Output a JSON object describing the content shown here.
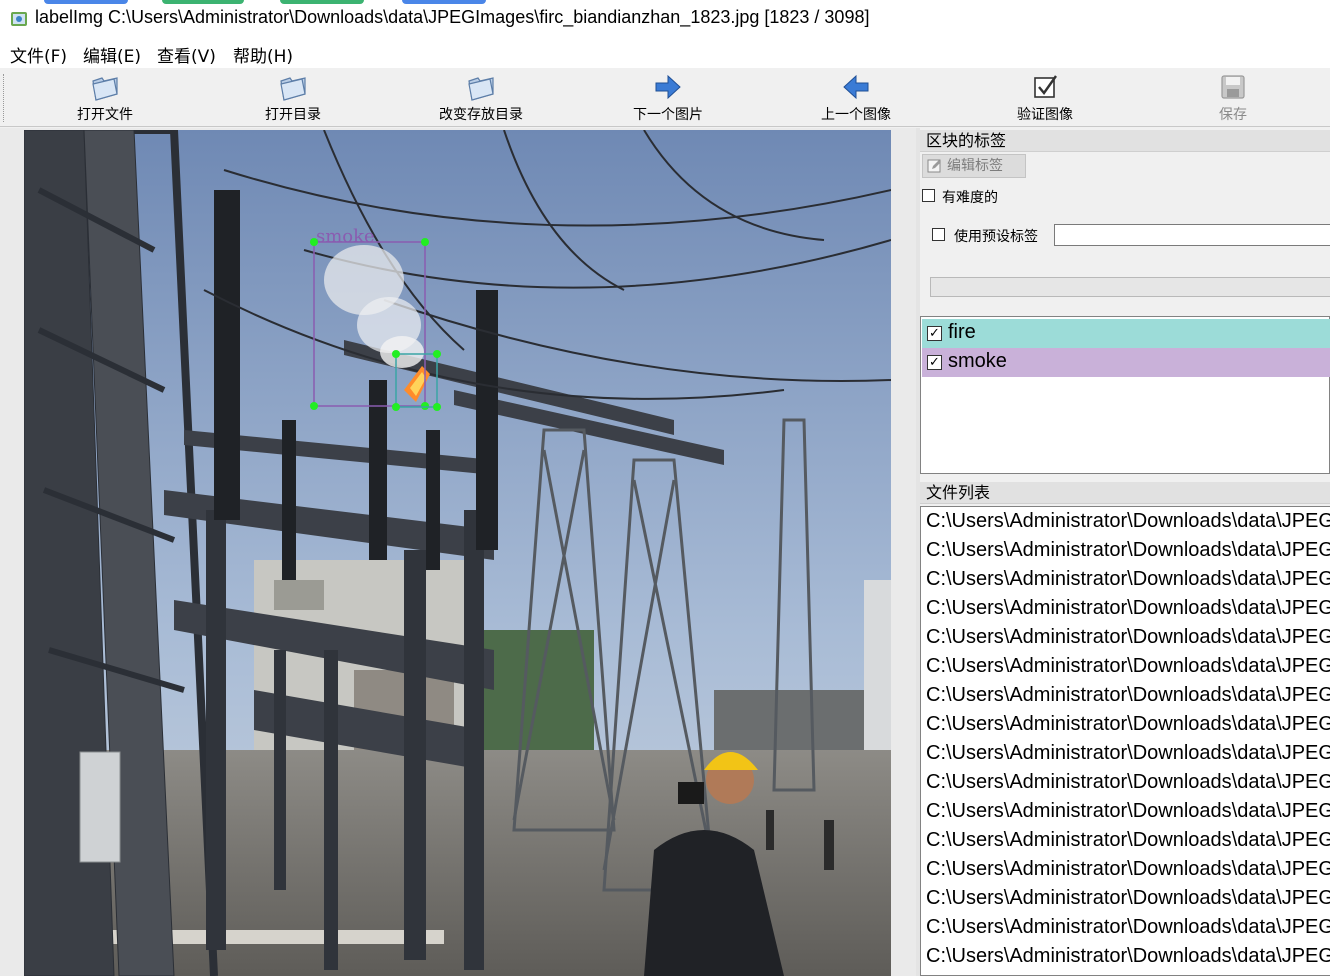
{
  "window": {
    "title": "labelImg C:\\Users\\Administrator\\Downloads\\data\\JPEGImages\\firc_biandianzhan_1823.jpg [1823 / 3098]"
  },
  "menu": {
    "items": [
      {
        "label": "文件(F)"
      },
      {
        "label": "编辑(E)"
      },
      {
        "label": "查看(V)"
      },
      {
        "label": "帮助(H)"
      }
    ]
  },
  "toolbar": {
    "open_file": "打开文件",
    "open_dir": "打开目录",
    "change_save_dir": "改变存放目录",
    "next_image": "下一个图片",
    "prev_image": "上一个图像",
    "verify_image": "验证图像",
    "save": "保存"
  },
  "canvas": {
    "boxes": [
      {
        "label": "smoke"
      },
      {
        "label": "fire"
      }
    ]
  },
  "box_labels_panel": {
    "title": "区块的标签",
    "edit_label": "编辑标签",
    "difficult": "有难度的",
    "use_default_label": "使用预设标签",
    "default_label_value": "",
    "labels": [
      {
        "name": "fire",
        "checked": true,
        "color": "#9cdcd8"
      },
      {
        "name": "smoke",
        "checked": true,
        "color": "#c9b1d9"
      }
    ]
  },
  "file_list_panel": {
    "title": "文件列表",
    "files": [
      "C:\\Users\\Administrator\\Downloads\\data\\JPEGImages",
      "C:\\Users\\Administrator\\Downloads\\data\\JPEGImages",
      "C:\\Users\\Administrator\\Downloads\\data\\JPEGImages",
      "C:\\Users\\Administrator\\Downloads\\data\\JPEGImages",
      "C:\\Users\\Administrator\\Downloads\\data\\JPEGImages",
      "C:\\Users\\Administrator\\Downloads\\data\\JPEGImages",
      "C:\\Users\\Administrator\\Downloads\\data\\JPEGImages",
      "C:\\Users\\Administrator\\Downloads\\data\\JPEGImages",
      "C:\\Users\\Administrator\\Downloads\\data\\JPEGImages",
      "C:\\Users\\Administrator\\Downloads\\data\\JPEGImages",
      "C:\\Users\\Administrator\\Downloads\\data\\JPEGImages",
      "C:\\Users\\Administrator\\Downloads\\data\\JPEGImages",
      "C:\\Users\\Administrator\\Downloads\\data\\JPEGImages",
      "C:\\Users\\Administrator\\Downloads\\data\\JPEGImages",
      "C:\\Users\\Administrator\\Downloads\\data\\JPEGImages",
      "C:\\Users\\Administrator\\Downloads\\data\\JPEGImages"
    ]
  },
  "colors": {
    "fire_label_bg": "#9cdcd8",
    "smoke_label_bg": "#c9b1d9",
    "box_handle": "#22ee22",
    "smoke_box_stroke": "#8a5cb0",
    "fire_box_stroke": "#3aa5a5",
    "toolbar_icon_blue": "#3a7bd5"
  }
}
